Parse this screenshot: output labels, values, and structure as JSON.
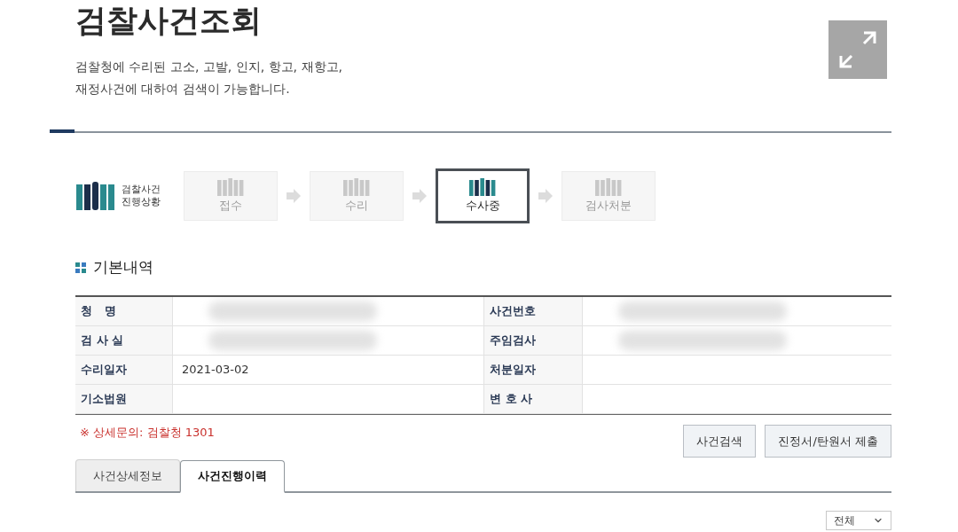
{
  "page": {
    "title": "검찰사건조회",
    "description_lines": [
      "검찰청에 수리된 고소, 고발, 인지, 항고, 재항고,",
      "재정사건에 대하여 검색이 가능합니다."
    ]
  },
  "progress": {
    "label_lines": [
      "검찰사건",
      "진행상황"
    ],
    "steps": [
      {
        "label": "접수",
        "current": false
      },
      {
        "label": "수리",
        "current": false
      },
      {
        "label": "수사중",
        "current": true
      },
      {
        "label": "검사처분",
        "current": false
      }
    ]
  },
  "basic_info": {
    "title": "기본내역",
    "rows": [
      {
        "cells": [
          {
            "label": "청   명",
            "redacted": true
          },
          {
            "label": "사건번호",
            "redacted": true
          }
        ]
      },
      {
        "cells": [
          {
            "label": "검 사 실",
            "redacted": true
          },
          {
            "label": "주임검사",
            "redacted": true
          }
        ]
      },
      {
        "cells": [
          {
            "label": "수리일자",
            "value": "2021-03-02"
          },
          {
            "label": "처분일자"
          }
        ]
      },
      {
        "cells": [
          {
            "label": "기소법원"
          },
          {
            "label": "변 호 사"
          }
        ]
      }
    ],
    "note": "※ 상세문의: 검찰청 1301"
  },
  "buttons": [
    "사건검색",
    "진정서/탄원서 제출"
  ],
  "tabs": [
    {
      "label": "사건상세정보",
      "selected": false
    },
    {
      "label": "사건진행이력",
      "selected": true
    }
  ],
  "filter": {
    "value": "전체"
  }
}
